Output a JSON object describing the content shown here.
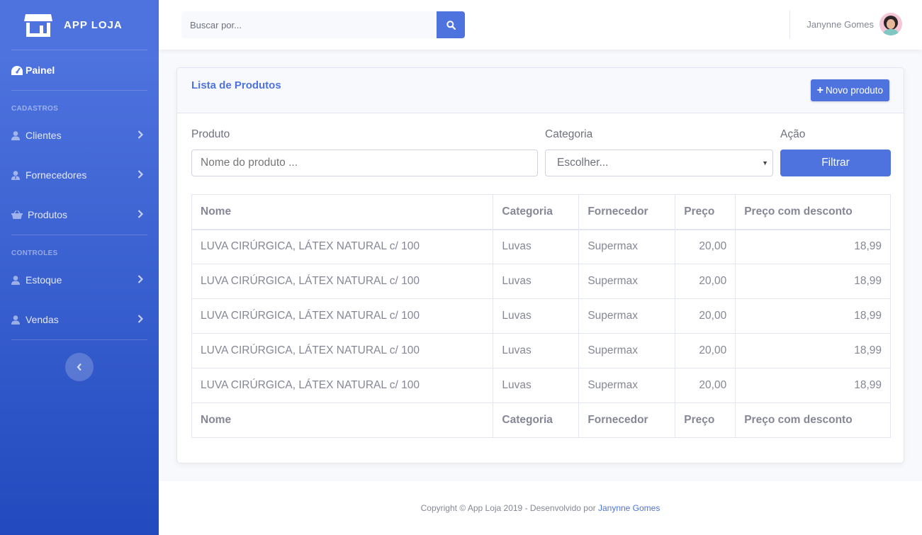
{
  "brand": {
    "name": "APP LOJA",
    "icon": "store-icon"
  },
  "sidebar": {
    "dashboard": {
      "label": "Painel",
      "icon": "tachometer-icon"
    },
    "sections": [
      {
        "heading": "Cadastros",
        "items": [
          {
            "label": "Clientes",
            "icon": "user-icon"
          },
          {
            "label": "Fornecedores",
            "icon": "user-tie-icon"
          },
          {
            "label": "Produtos",
            "icon": "basket-icon"
          }
        ]
      },
      {
        "heading": "Controles",
        "items": [
          {
            "label": "Estoque",
            "icon": "user-icon"
          },
          {
            "label": "Vendas",
            "icon": "user-icon"
          }
        ]
      }
    ],
    "toggle_icon": "chevron-left-icon"
  },
  "topbar": {
    "search_placeholder": "Buscar por...",
    "search_icon": "search-icon",
    "user_name": "Janynne Gomes"
  },
  "card": {
    "title": "Lista de Produtos",
    "new_button": "Novo produto",
    "filters": {
      "product_label": "Produto",
      "product_placeholder": "Nome do produto ...",
      "category_label": "Categoria",
      "category_value": "Escolher...",
      "action_label": "Ação",
      "filter_button": "Filtrar"
    },
    "table": {
      "columns": [
        "Nome",
        "Categoria",
        "Fornecedor",
        "Preço",
        "Preço com desconto"
      ],
      "rows": [
        [
          "LUVA CIRÚRGICA, LÁTEX NATURAL c/ 100",
          "Luvas",
          "Supermax",
          "20,00",
          "18,99"
        ],
        [
          "LUVA CIRÚRGICA, LÁTEX NATURAL c/ 100",
          "Luvas",
          "Supermax",
          "20,00",
          "18,99"
        ],
        [
          "LUVA CIRÚRGICA, LÁTEX NATURAL c/ 100",
          "Luvas",
          "Supermax",
          "20,00",
          "18,99"
        ],
        [
          "LUVA CIRÚRGICA, LÁTEX NATURAL c/ 100",
          "Luvas",
          "Supermax",
          "20,00",
          "18,99"
        ],
        [
          "LUVA CIRÚRGICA, LÁTEX NATURAL c/ 100",
          "Luvas",
          "Supermax",
          "20,00",
          "18,99"
        ]
      ]
    }
  },
  "footer": {
    "text": "Copyright © App Loja 2019 - Desenvolvido por ",
    "author": "Janynne Gomes"
  },
  "colors": {
    "primary": "#4e73df",
    "primary_dark": "#224abe",
    "text": "#858796"
  }
}
